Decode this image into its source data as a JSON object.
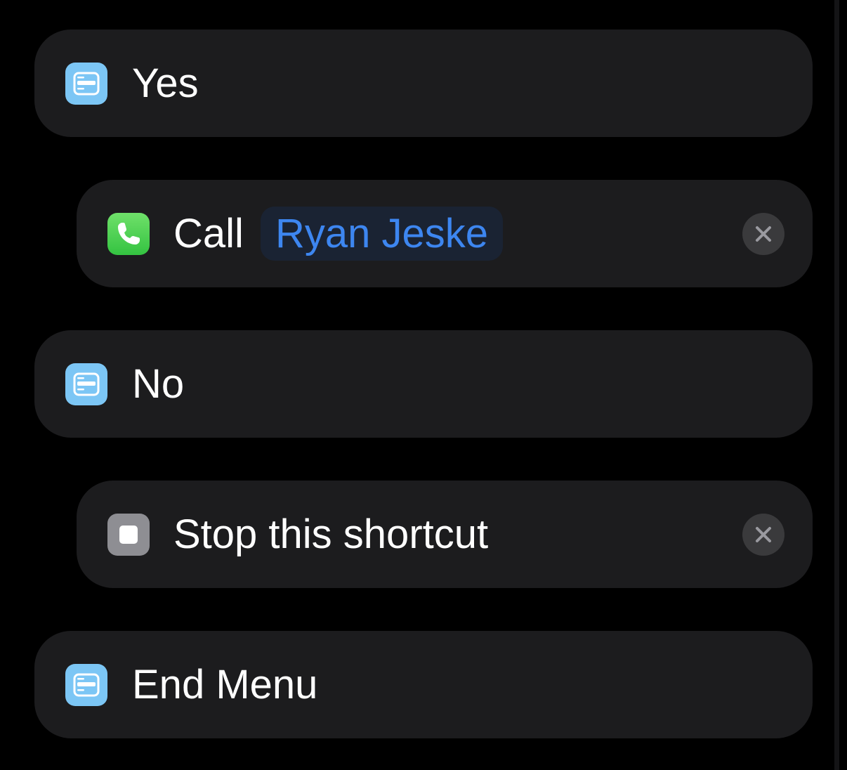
{
  "actions": [
    {
      "label": "Yes",
      "icon": "menu-icon"
    },
    {
      "label": "Call",
      "icon": "phone-icon",
      "contact": "Ryan Jeske",
      "remove_icon": "close-icon"
    },
    {
      "label": "No",
      "icon": "menu-icon"
    },
    {
      "label": "Stop this shortcut",
      "icon": "stop-icon",
      "remove_icon": "close-icon"
    },
    {
      "label": "End Menu",
      "icon": "menu-icon"
    }
  ],
  "colors": {
    "background": "#000000",
    "card": "#1c1c1e",
    "menu_icon": "#7cc6f5",
    "phone_icon": "#34c341",
    "stop_icon": "#8e8e93",
    "token_text": "#3d86f0",
    "token_background": "#1a2333",
    "remove_button": "#3a3a3c"
  }
}
